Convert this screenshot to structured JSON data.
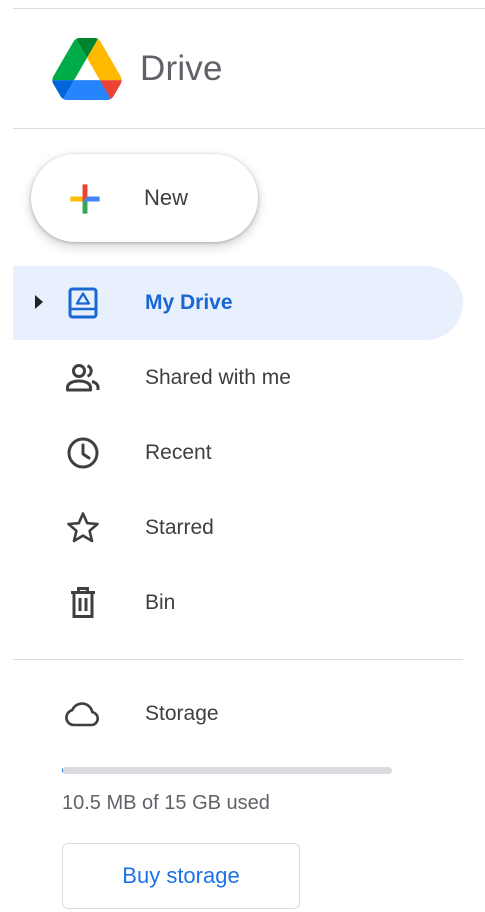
{
  "app": {
    "name": "Drive"
  },
  "new_button": {
    "label": "New"
  },
  "nav": {
    "items": [
      {
        "label": "My Drive",
        "icon": "my-drive-icon",
        "active": true
      },
      {
        "label": "Shared with me",
        "icon": "shared-with-me-icon",
        "active": false
      },
      {
        "label": "Recent",
        "icon": "clock-icon",
        "active": false
      },
      {
        "label": "Starred",
        "icon": "star-icon",
        "active": false
      },
      {
        "label": "Bin",
        "icon": "bin-icon",
        "active": false
      }
    ]
  },
  "storage": {
    "label": "Storage",
    "icon": "cloud-icon",
    "used_text": "10.5 MB of 15 GB used",
    "used_fraction": 0.0007,
    "buy_label": "Buy storage"
  },
  "colors": {
    "accent": "#1a73e8",
    "active_bg": "#e8f0fe",
    "active_text": "#1967d2",
    "logo_green": "#1ea362",
    "logo_yellow": "#ffba00",
    "logo_blue": "#4285f4",
    "logo_red": "#ea4335"
  }
}
